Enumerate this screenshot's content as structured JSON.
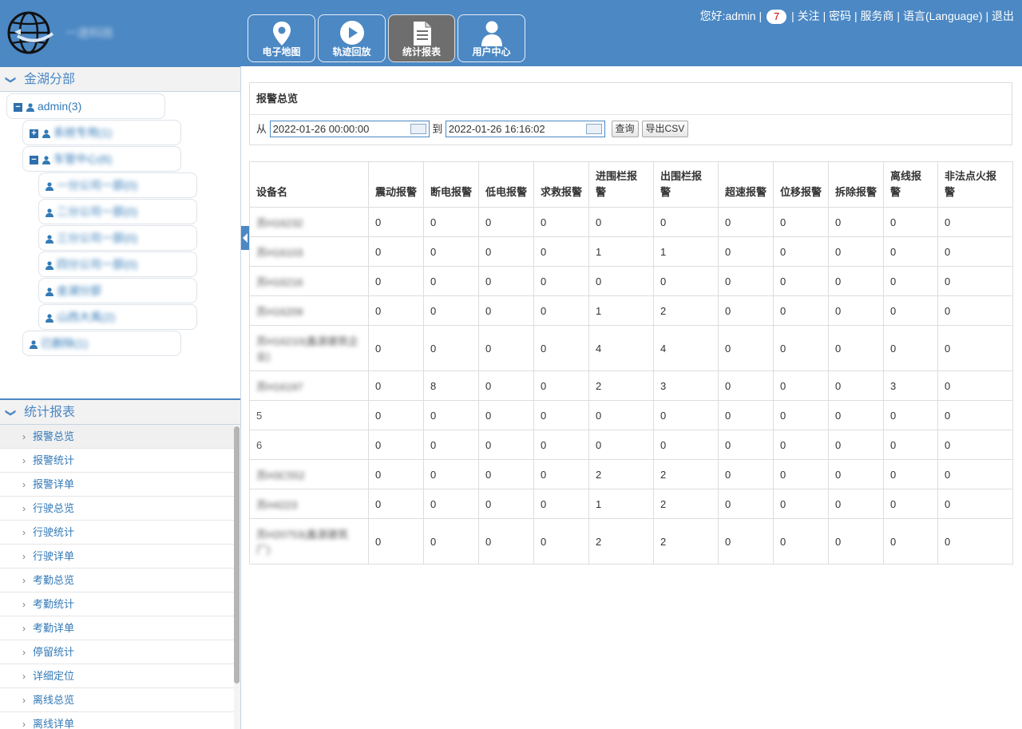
{
  "header": {
    "logo_text": "一途科技",
    "nav": [
      {
        "label": "电子地图",
        "icon": "map-pin-icon"
      },
      {
        "label": "轨迹回放",
        "icon": "play-icon"
      },
      {
        "label": "统计报表",
        "icon": "document-icon"
      },
      {
        "label": "用户中心",
        "icon": "user-icon"
      }
    ],
    "active_nav": "统计报表",
    "greeting": "您好:admin",
    "sep": "|",
    "badge_count": "7",
    "links": [
      "关注",
      "密码",
      "服务商",
      "语言(Language)",
      "退出"
    ]
  },
  "sidebar": {
    "tree_title": "金湖分部",
    "tree": [
      {
        "label": "admin(3)",
        "toggle": "−"
      },
      {
        "label": "系统专用(1)",
        "toggle": "+"
      },
      {
        "label": "车管中心(6)",
        "toggle": "−"
      },
      {
        "label": "一分公司一部(0)"
      },
      {
        "label": "二分公司一部(0)"
      },
      {
        "label": "三分公司一部(0)"
      },
      {
        "label": "四分公司一部(0)"
      },
      {
        "label": "金湖分部"
      },
      {
        "label": "山西大禹(2)"
      },
      {
        "label": "已删除(1)"
      }
    ],
    "menu_title": "统计报表",
    "menu": [
      "报警总览",
      "报警统计",
      "报警详单",
      "行驶总览",
      "行驶统计",
      "行驶详单",
      "考勤总览",
      "考勤统计",
      "考勤详单",
      "停留统计",
      "详细定位",
      "离线总览",
      "离线详单"
    ],
    "menu_active": "报警总览"
  },
  "query": {
    "title": "报警总览",
    "from_label": "从",
    "from_value": "2022-01-26 00:00:00",
    "to_label": "到",
    "to_value": "2022-01-26 16:16:02",
    "search_label": "查询",
    "export_label": "导出CSV"
  },
  "table": {
    "headers": [
      "设备名",
      "震动报警",
      "断电报警",
      "低电报警",
      "求救报警",
      "进围栏报警",
      "出围栏报警",
      "超速报警",
      "位移报警",
      "拆除报警",
      "离线报警",
      "非法点火报警"
    ],
    "rows": [
      {
        "name": "苏H16232",
        "blur": true,
        "vals": [
          "0",
          "0",
          "0",
          "0",
          "0",
          "0",
          "0",
          "0",
          "0",
          "0",
          "0"
        ]
      },
      {
        "name": "苏H16103",
        "blur": true,
        "vals": [
          "0",
          "0",
          "0",
          "0",
          "1",
          "1",
          "0",
          "0",
          "0",
          "0",
          "0"
        ]
      },
      {
        "name": "苏H16216",
        "blur": true,
        "vals": [
          "0",
          "0",
          "0",
          "0",
          "0",
          "0",
          "0",
          "0",
          "0",
          "0",
          "0"
        ]
      },
      {
        "name": "苏H16209",
        "blur": true,
        "vals": [
          "0",
          "0",
          "0",
          "0",
          "1",
          "2",
          "0",
          "0",
          "0",
          "0",
          "0"
        ]
      },
      {
        "name": "苏H16210(鑫源建筑企业)",
        "blur": true,
        "tall": true,
        "vals": [
          "0",
          "0",
          "0",
          "0",
          "4",
          "4",
          "0",
          "0",
          "0",
          "0",
          "0"
        ]
      },
      {
        "name": "苏H16197",
        "blur": true,
        "vals": [
          "0",
          "8",
          "0",
          "0",
          "2",
          "3",
          "0",
          "0",
          "0",
          "3",
          "0"
        ]
      },
      {
        "name": "5",
        "blur": false,
        "vals": [
          "0",
          "0",
          "0",
          "0",
          "0",
          "0",
          "0",
          "0",
          "0",
          "0",
          "0"
        ]
      },
      {
        "name": "6",
        "blur": false,
        "vals": [
          "0",
          "0",
          "0",
          "0",
          "0",
          "0",
          "0",
          "0",
          "0",
          "0",
          "0"
        ]
      },
      {
        "name": "苏H3C552",
        "blur": true,
        "vals": [
          "0",
          "0",
          "0",
          "0",
          "2",
          "2",
          "0",
          "0",
          "0",
          "0",
          "0"
        ]
      },
      {
        "name": "苏H4223",
        "blur": true,
        "vals": [
          "0",
          "0",
          "0",
          "0",
          "1",
          "2",
          "0",
          "0",
          "0",
          "0",
          "0"
        ]
      },
      {
        "name": "苏H20753(鑫源建筑厂)",
        "blur": true,
        "tall": true,
        "vals": [
          "0",
          "0",
          "0",
          "0",
          "2",
          "2",
          "0",
          "0",
          "0",
          "0",
          "0"
        ]
      }
    ]
  },
  "colors": {
    "header_bg": "#4b88c4",
    "active_nav_bg": "#6e6e6e",
    "link": "#337ab7"
  }
}
